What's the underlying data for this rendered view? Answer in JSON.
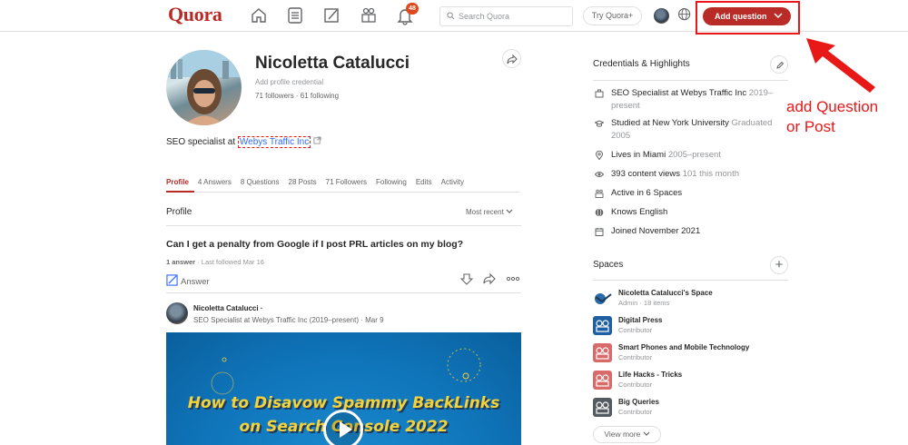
{
  "header": {
    "logo": "Quora",
    "notification_count": "48",
    "search_placeholder": "Search Quora",
    "try_quora": "Try Quora+",
    "add_question": "Add question",
    "nav_icons": [
      "home-icon",
      "following-icon",
      "answer-icon",
      "spaces-icon",
      "notifications-icon"
    ]
  },
  "annotation": {
    "line1": "add Question",
    "line2": "or Post",
    "color": "#e81818"
  },
  "profile": {
    "name": "Nicoletta Catalucci",
    "credential_placeholder": "Add profile credential",
    "follows": "71 followers · 61 following",
    "bio_prefix": "SEO specialist at ",
    "bio_link": "Webys Traffic Inc"
  },
  "tabs": [
    {
      "label": "Profile"
    },
    {
      "label": "4 Answers"
    },
    {
      "label": "8 Questions"
    },
    {
      "label": "28 Posts"
    },
    {
      "label": "71 Followers"
    },
    {
      "label": "Following"
    },
    {
      "label": "Edits"
    },
    {
      "label": "Activity"
    }
  ],
  "feed": {
    "section_title": "Profile",
    "sort_label": "Most recent",
    "question": {
      "title": "Can I get a penalty from Google if I post PRL articles on my blog?",
      "answers": "1 answer",
      "meta": " · Last followed Mar 16",
      "answer_label": "Answer"
    },
    "post": {
      "author": "Nicoletta Catalucci ·",
      "meta": "SEO Specialist at Webys Traffic Inc (2019–present) · Mar 9",
      "image_title_line1": "How to Disavow Spammy BackLinks",
      "image_title_line2": "on Search Console 2022"
    }
  },
  "credentials": {
    "title": "Credentials & Highlights",
    "items": [
      {
        "text": "SEO Specialist at Webys Traffic Inc ",
        "grey": "2019–present",
        "icon": "briefcase-icon"
      },
      {
        "text": "Studied at New York University ",
        "grey": "Graduated 2005",
        "icon": "graduation-icon"
      },
      {
        "text": "Lives in Miami ",
        "grey": "2005–present",
        "icon": "location-icon"
      },
      {
        "text": "393 content views ",
        "grey": "101 this month",
        "icon": "eye-icon"
      },
      {
        "text": "Active in 6 Spaces",
        "grey": "",
        "icon": "spaces-icon"
      },
      {
        "text": "Knows English",
        "grey": "",
        "icon": "globe-icon"
      },
      {
        "text": "Joined November 2021",
        "grey": "",
        "icon": "calendar-icon"
      }
    ]
  },
  "spaces": {
    "title": "Spaces",
    "items": [
      {
        "name": "Nicoletta Catalucci's Space",
        "sub": "Admin · 18 items",
        "color": "#2b6aa8"
      },
      {
        "name": "Digital Press",
        "sub": "Contributor",
        "color": "#1f5fa3"
      },
      {
        "name": "Smart Phones and Mobile Technology",
        "sub": "Contributor",
        "color": "#d96a6a"
      },
      {
        "name": "Life Hacks - Tricks",
        "sub": "Contributor",
        "color": "#d96a6a"
      },
      {
        "name": "Big Queries",
        "sub": "Contributor",
        "color": "#555a60"
      }
    ],
    "view_more": "View more"
  }
}
